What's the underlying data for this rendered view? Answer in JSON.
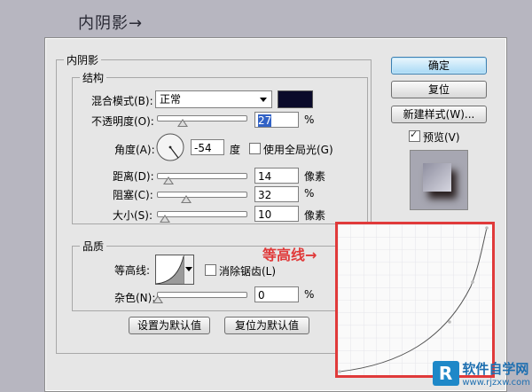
{
  "page_title": "内阴影→",
  "group_main": "内阴影",
  "group_structure": "结构",
  "blend_mode": {
    "label": "混合模式(B):",
    "value": "正常",
    "color": "#0a0a2a"
  },
  "opacity": {
    "label": "不透明度(O):",
    "value": "27",
    "unit": "%",
    "level": 0.27
  },
  "angle": {
    "label": "角度(A):",
    "value": "-54",
    "unit": "度",
    "global_light_label": "使用全局光(G)",
    "global_light_checked": false
  },
  "distance": {
    "label": "距离(D):",
    "value": "14",
    "unit": "像素",
    "level": 0.12
  },
  "choke": {
    "label": "阻塞(C):",
    "value": "32",
    "unit": "%",
    "level": 0.32
  },
  "size": {
    "label": "大小(S):",
    "value": "10",
    "unit": "像素",
    "level": 0.05
  },
  "group_quality": "品质",
  "contour": {
    "label": "等高线:",
    "antialias_label": "消除锯齿(L)",
    "antialias_checked": false
  },
  "noise": {
    "label": "杂色(N):",
    "value": "0",
    "unit": "%",
    "level": 0.0
  },
  "buttons": {
    "make_default": "设置为默认值",
    "reset_default": "复位为默认值",
    "ok": "确定",
    "reset": "复位",
    "new_style": "新建样式(W)...",
    "preview_label": "预览(V)",
    "preview_checked": true
  },
  "annotation": "等高线→",
  "watermark": {
    "logo": "R",
    "name": "软件自学网",
    "url": "www.rjzxw.com"
  }
}
